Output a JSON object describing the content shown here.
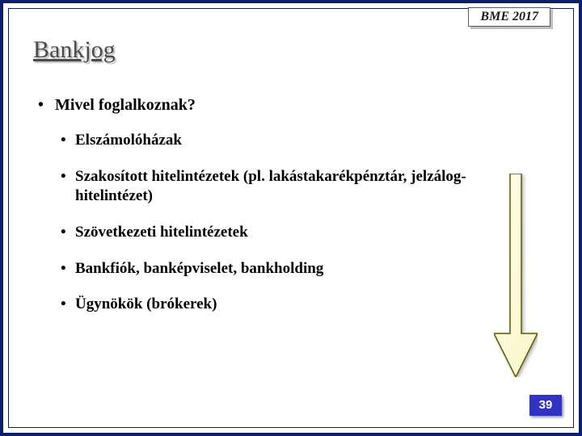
{
  "header": {
    "label": "BME   2017"
  },
  "title": "Bankjog",
  "content": {
    "heading": "Mivel foglalkoznak?",
    "items": [
      "Elszámolóházak",
      "Szakosított hitelintézetek (pl. lakástakarékpénztár, jelzálog-hitelintézet)",
      "Szövetkezeti hitelintézetek",
      "Bankfiók, banképviselet, bankholding",
      "Ügynökök (brókerek)"
    ]
  },
  "page_number": "39"
}
